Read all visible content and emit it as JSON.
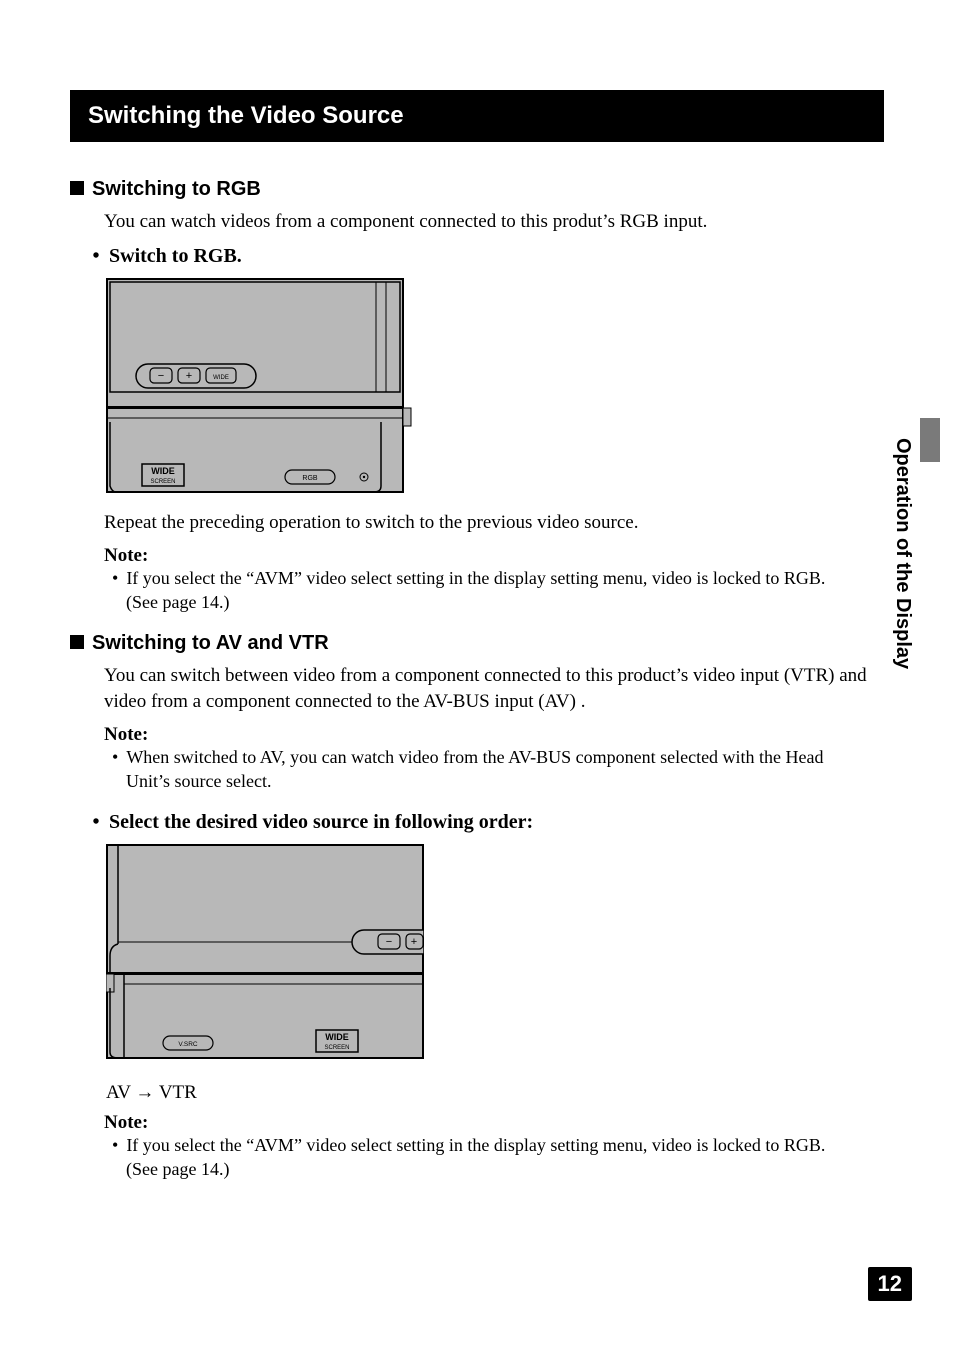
{
  "title": "Switching the Video Source",
  "section1": {
    "heading": "Switching to RGB",
    "intro": "You can watch videos from a component connected to this produt’s RGB input.",
    "step": "Switch to RGB.",
    "afterDiagram": "Repeat the preceding operation to switch to the previous video source.",
    "noteLabel": "Note:",
    "noteItem": "If you select the “AVM” video select setting in the display setting menu, video is locked to RGB. (See page 14.)"
  },
  "section2": {
    "heading": "Switching to AV and VTR",
    "intro": "You can switch between video from a component connected to this product’s video input (VTR) and video from a component connected to the AV-BUS input (AV) .",
    "note1Label": "Note:",
    "note1Item": "When switched to AV, you can watch video from the AV-BUS component selected with the Head Unit’s source select.",
    "step": "Select the desired video source in following order:",
    "seqA": "AV",
    "seqArrow": "→",
    "seqB": "VTR",
    "note2Label": "Note:",
    "note2Item": "If you select the “AVM” video select setting in the display setting menu, video is locked to RGB. (See page 14.)"
  },
  "diagram": {
    "wideLabel": "WIDE",
    "screenLabel": "SCREEN",
    "rgbBtn": "RGB",
    "wideBtn": "WIDE",
    "vsrcBtn": "V.SRC",
    "minus": "−",
    "plus": "+"
  },
  "sideTab": "Operation of the Display",
  "pageNumber": "12"
}
